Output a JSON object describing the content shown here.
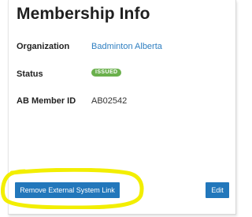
{
  "card": {
    "title": "Membership Info",
    "rows": [
      {
        "label": "Organization",
        "value": "Badminton Alberta"
      },
      {
        "label": "Status",
        "value": "ISSUED"
      },
      {
        "label": "AB Member ID",
        "value": "AB02542"
      }
    ],
    "remove_button_label": "Remove External System Link",
    "edit_button_label": "Edit"
  },
  "colors": {
    "link": "#2f7fc1",
    "badge_issued": "#6ab04c",
    "button": "#2277bb",
    "highlight": "#f2ee00"
  }
}
